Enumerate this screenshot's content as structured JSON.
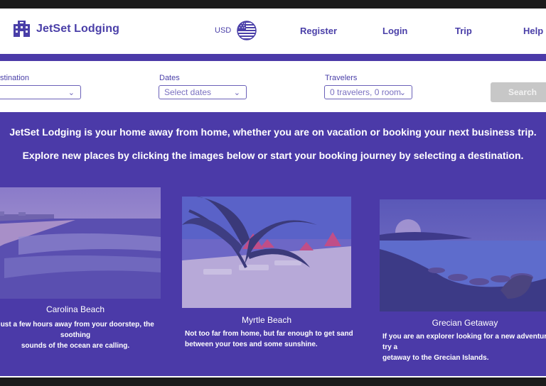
{
  "brand": {
    "name": "JetSet Lodging"
  },
  "currency": {
    "code": "USD",
    "flag_icon": "us-flag-icon"
  },
  "nav": {
    "register": "Register",
    "login": "Login",
    "trip": "Trip",
    "help": "Help"
  },
  "search": {
    "destination_label": "Destination",
    "destination_value": "",
    "dates_label": "Dates",
    "dates_placeholder": "Select dates",
    "travelers_label": "Travelers",
    "travelers_value": "0 travelers, 0 room",
    "button_label": "Search"
  },
  "hero": {
    "line1": "JetSet Lodging is your home away from home, whether you are on vacation or booking your next business trip.",
    "line2": "Explore new places by clicking the images below or start your booking journey by selecting a destination."
  },
  "cards": [
    {
      "title": "Carolina Beach",
      "desc1": "Just a few hours away from your doorstep, the soothing",
      "desc2": "sounds of the ocean are calling."
    },
    {
      "title": "Myrtle Beach",
      "desc1": "Not too far from home, but far enough to get sand",
      "desc2": "between your toes and some sunshine."
    },
    {
      "title": "Grecian Getaway",
      "desc1": "If you are an explorer looking for a new adventure, try a",
      "desc2": "getaway to the Grecian Islands."
    }
  ],
  "colors": {
    "brand": "#4a3fa8",
    "panel": "#4b3aa8",
    "button_disabled": "#c7c7c7"
  }
}
